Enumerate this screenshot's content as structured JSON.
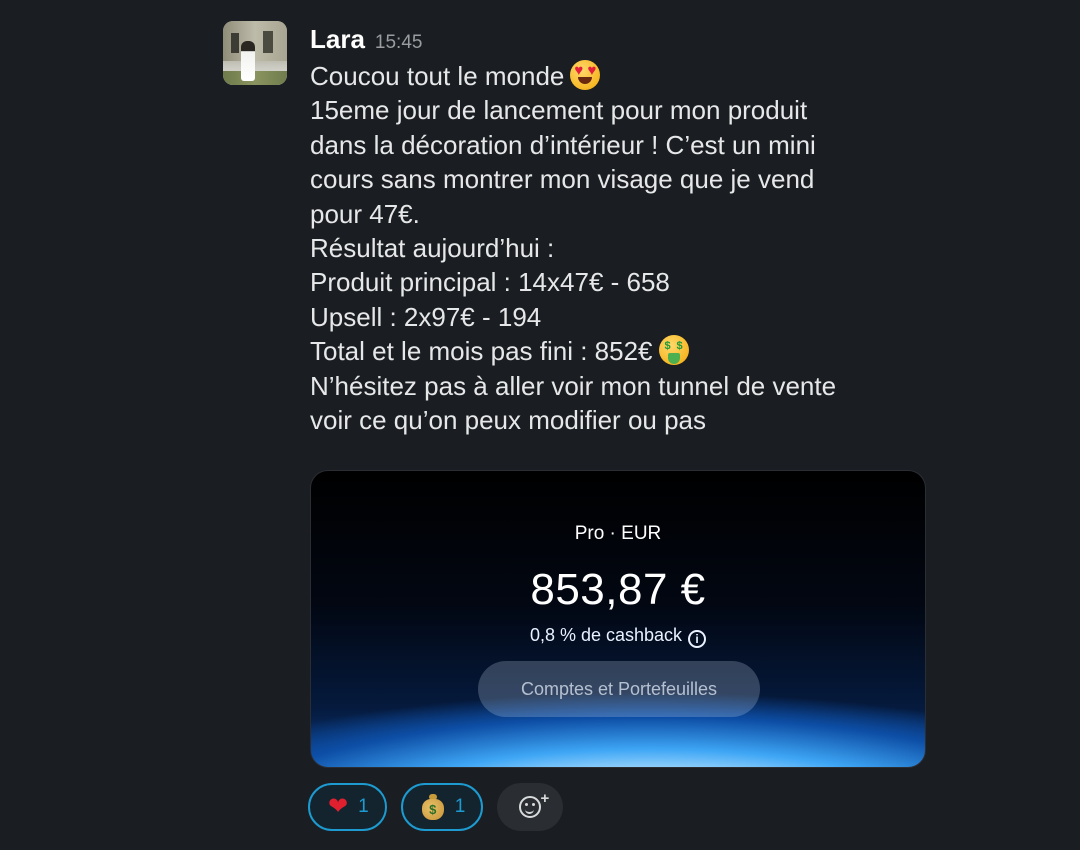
{
  "message": {
    "sender": "Lara",
    "time": "15:45",
    "lines": [
      "Coucou tout le monde",
      "15eme jour de lancement pour mon produit",
      "dans la décoration d’intérieur ! C’est un mini",
      "cours sans montrer mon visage que je vend",
      "pour 47€.",
      "Résultat aujourd’hui :",
      "Produit principal : 14x47€ - 658",
      "Upsell : 2x97€ - 194",
      "Total et le mois pas fini : 852€",
      "N’hésitez pas à aller voir mon tunnel de vente",
      "voir ce qu’on peux modifier ou pas"
    ],
    "emoji_line1": "smiling-face-with-heart-eyes",
    "emoji_line9": "money-mouth-face"
  },
  "card": {
    "subtitle": "Pro · EUR",
    "amount": "853,87 €",
    "cashback": "0,8 % de cashback",
    "button_label": "Comptes et Portefeuilles"
  },
  "reactions": [
    {
      "icon": "heart-icon",
      "count": "1"
    },
    {
      "icon": "money-bag-icon",
      "count": "1"
    }
  ],
  "colors": {
    "background": "#1a1d21",
    "reaction_accent": "#1d9bd1"
  }
}
